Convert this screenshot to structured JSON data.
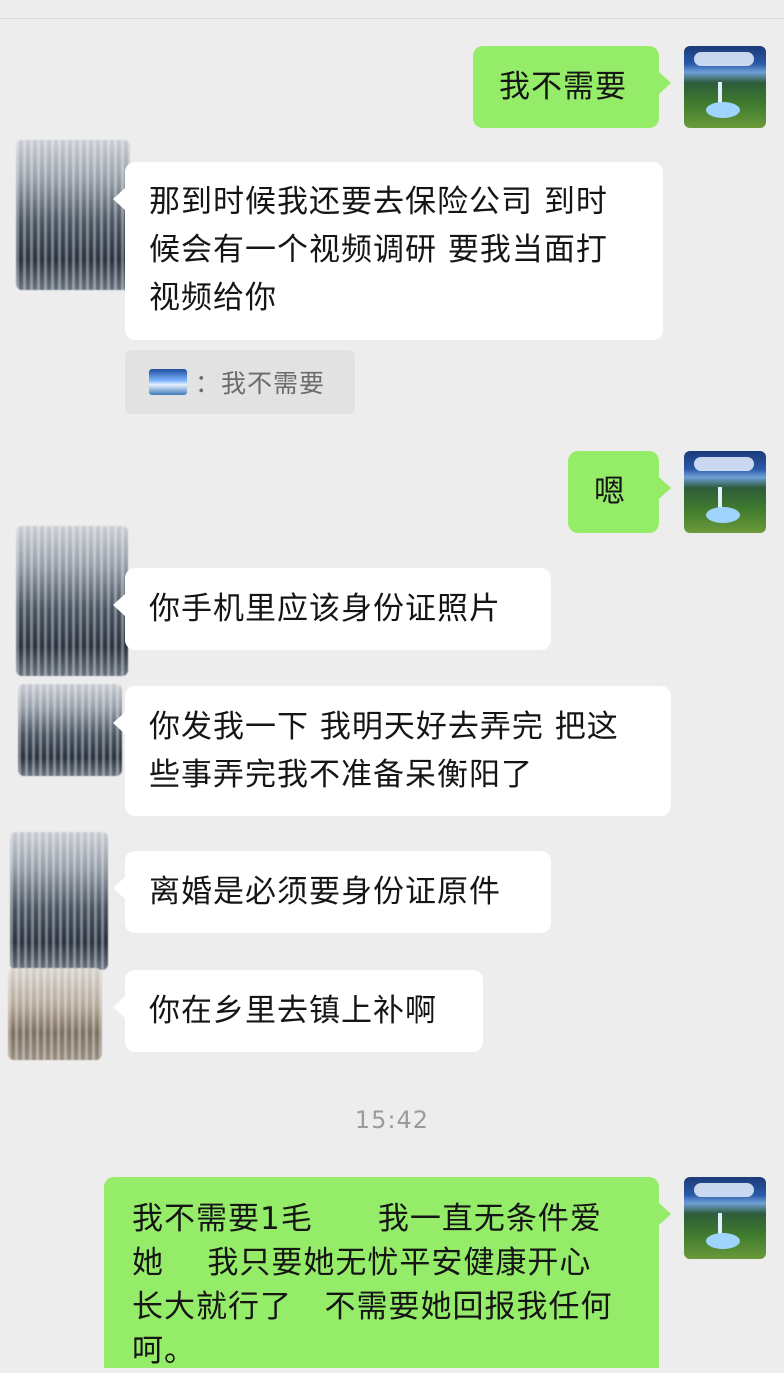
{
  "chat": {
    "messages": [
      {
        "side": "right",
        "text": "我不需要"
      },
      {
        "side": "left",
        "text": "那到时候我还要去保险公司 到时\n候会有一个视频调研 要我当面打\n视频给你"
      },
      {
        "side": "right",
        "text": "嗯"
      },
      {
        "side": "left",
        "text": "你手机里应该身份证照片"
      },
      {
        "side": "left",
        "text": "你发我一下 我明天好去弄完 把这\n些事弄完我不准备呆衡阳了"
      },
      {
        "side": "left",
        "text": "离婚是必须要身份证原件"
      },
      {
        "side": "left",
        "text": "你在乡里去镇上补啊"
      },
      {
        "side": "right",
        "text": "我不需要1毛      我一直无条件爱\n她    我只要她无忧平安健康开心\n长大就行了   不需要她回报我任何\n呵。"
      }
    ],
    "quote": {
      "separator": "：",
      "text": "我不需要"
    },
    "timestamp": "15:42"
  },
  "colors": {
    "background": "#ededed",
    "sent_bubble": "#95ec69",
    "received_bubble": "#ffffff"
  },
  "icons": {
    "self_avatar": "landscape-avatar-icon",
    "other_avatar": "blurred-avatar-icon"
  }
}
